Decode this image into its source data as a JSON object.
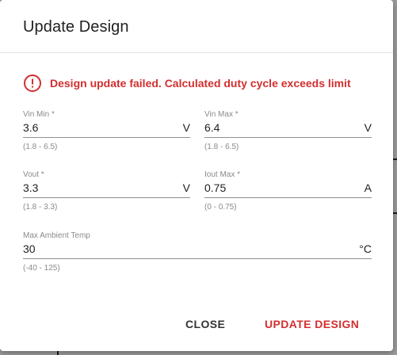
{
  "dialog": {
    "title": "Update Design",
    "error": {
      "icon": "error-outline-icon",
      "message": "Design update failed. Calculated duty cycle exceeds limit",
      "color": "#d32f2f"
    },
    "fields": {
      "vin_min": {
        "label": "Vin Min *",
        "value": "3.6",
        "unit": "V",
        "hint": "(1.8 - 6.5)"
      },
      "vin_max": {
        "label": "Vin Max *",
        "value": "6.4",
        "unit": "V",
        "hint": "(1.8 - 6.5)"
      },
      "vout": {
        "label": "Vout *",
        "value": "3.3",
        "unit": "V",
        "hint": "(1.8 - 3.3)"
      },
      "iout_max": {
        "label": "Iout Max *",
        "value": "0.75",
        "unit": "A",
        "hint": "(0 - 0.75)"
      },
      "max_ambient_temp": {
        "label": "Max Ambient Temp",
        "value": "30",
        "unit": "°C",
        "hint": "(-40 - 125)"
      }
    },
    "actions": {
      "close_label": "CLOSE",
      "update_label": "UPDATE DESIGN",
      "accent_color": "#d32f2f"
    }
  }
}
